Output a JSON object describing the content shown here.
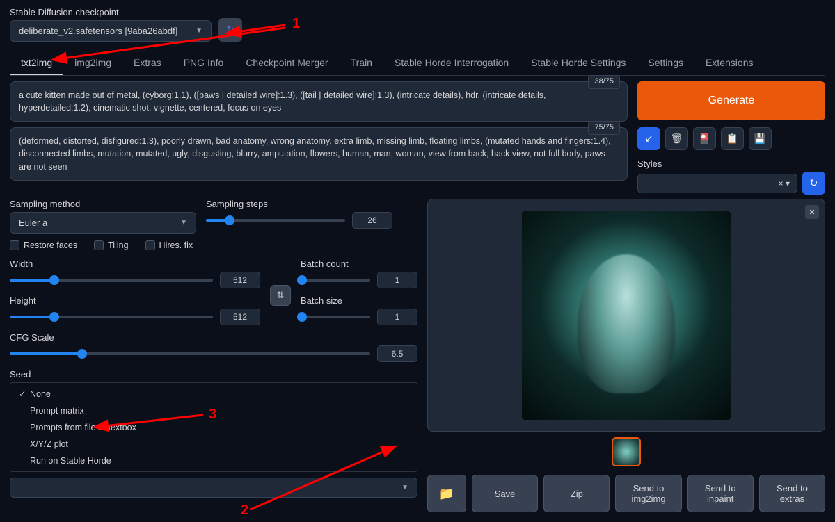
{
  "checkpoint": {
    "label": "Stable Diffusion checkpoint",
    "value": "deliberate_v2.safetensors [9aba26abdf]"
  },
  "tabs": [
    "txt2img",
    "img2img",
    "Extras",
    "PNG Info",
    "Checkpoint Merger",
    "Train",
    "Stable Horde Interrogation",
    "Stable Horde Settings",
    "Settings",
    "Extensions"
  ],
  "active_tab": "txt2img",
  "prompt": {
    "tokens": "38/75",
    "text": "a cute kitten made out of metal, (cyborg:1.1), ([paws | detailed wire]:1.3), ([tail | detailed wire]:1.3), (intricate details), hdr, (intricate details, hyperdetailed:1.2), cinematic shot, vignette, centered, focus on eyes"
  },
  "neg_prompt": {
    "tokens": "75/75",
    "text": "(deformed, distorted, disfigured:1.3), poorly drawn, bad anatomy, wrong anatomy, extra limb, missing limb, floating limbs, (mutated hands and fingers:1.4), disconnected limbs, mutation, mutated, ugly, disgusting, blurry, amputation, flowers, human, man, woman, view from  back, back view, not full body, paws are not seen"
  },
  "generate_label": "Generate",
  "styles_label": "Styles",
  "params": {
    "sampling_method": {
      "label": "Sampling method",
      "value": "Euler a"
    },
    "sampling_steps": {
      "label": "Sampling steps",
      "value": "26",
      "pct": 17
    },
    "restore_faces": "Restore faces",
    "tiling": "Tiling",
    "hires_fix": "Hires. fix",
    "width": {
      "label": "Width",
      "value": "512",
      "pct": 22
    },
    "height": {
      "label": "Height",
      "value": "512",
      "pct": 22
    },
    "batch_count": {
      "label": "Batch count",
      "value": "1",
      "pct": 2
    },
    "batch_size": {
      "label": "Batch size",
      "value": "1",
      "pct": 2
    },
    "cfg": {
      "label": "CFG Scale",
      "value": "6.5",
      "pct": 20
    },
    "seed": {
      "label": "Seed"
    }
  },
  "script": {
    "options": [
      "None",
      "Prompt matrix",
      "Prompts from file or textbox",
      "X/Y/Z plot",
      "Run on Stable Horde"
    ],
    "selected": "None"
  },
  "output_buttons": {
    "save": "Save",
    "zip": "Zip",
    "img2img": "Send to img2img",
    "inpaint": "Send to inpaint",
    "extras": "Send to extras"
  },
  "annotations": {
    "a1": "1",
    "a2": "2",
    "a3": "3"
  }
}
